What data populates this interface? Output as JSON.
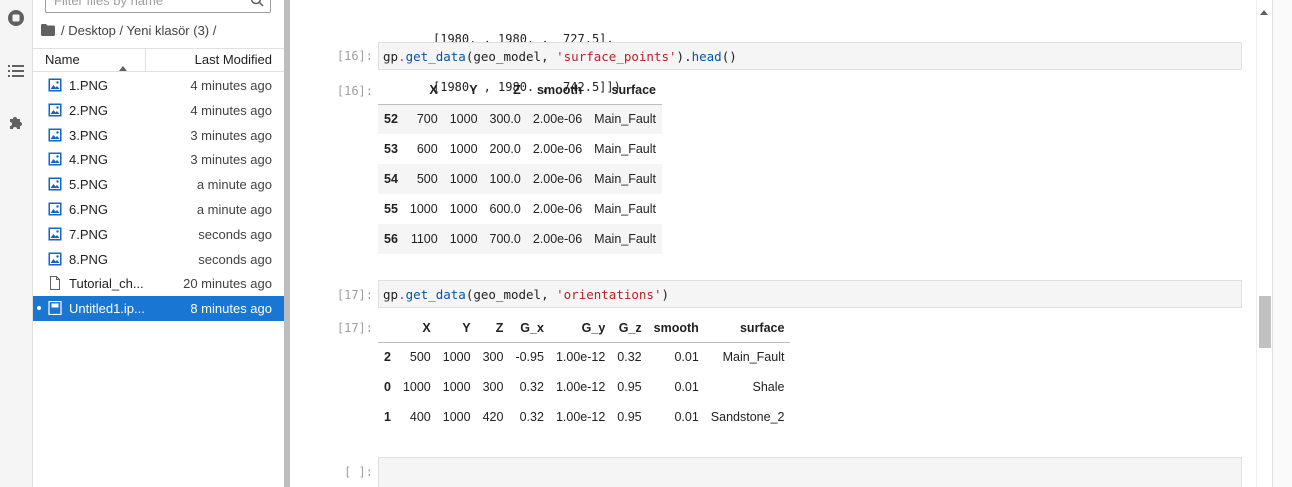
{
  "sidebar": {
    "icons": [
      "running-icon",
      "toc-icon",
      "extension-icon"
    ]
  },
  "filebrowser": {
    "search_placeholder": "Filter files by name",
    "breadcrumb": "/ Desktop / Yeni klasör (3) /",
    "header": {
      "name": "Name",
      "modified": "Last Modified"
    },
    "files": [
      {
        "name": "1.PNG",
        "modified": "4 minutes ago",
        "icon": "image-icon"
      },
      {
        "name": "2.PNG",
        "modified": "4 minutes ago",
        "icon": "image-icon"
      },
      {
        "name": "3.PNG",
        "modified": "3 minutes ago",
        "icon": "image-icon"
      },
      {
        "name": "4.PNG",
        "modified": "3 minutes ago",
        "icon": "image-icon"
      },
      {
        "name": "5.PNG",
        "modified": "a minute ago",
        "icon": "image-icon"
      },
      {
        "name": "6.PNG",
        "modified": "a minute ago",
        "icon": "image-icon"
      },
      {
        "name": "7.PNG",
        "modified": "seconds ago",
        "icon": "image-icon"
      },
      {
        "name": "8.PNG",
        "modified": "seconds ago",
        "icon": "image-icon"
      },
      {
        "name": "Tutorial_ch...",
        "modified": "20 minutes ago",
        "icon": "file-icon"
      },
      {
        "name": "Untitled1.ip...",
        "modified": "8 minutes ago",
        "icon": "notebook-icon",
        "selected": true
      }
    ]
  },
  "notebook": {
    "prev_output": {
      "line1": "[1980. , 1980. ,  727.5],",
      "line2": "[1980. , 1980. ,  742.5]])"
    },
    "cell16": {
      "in_prompt": "[16]:",
      "out_prompt": "[16]:",
      "code": {
        "obj": "gp",
        "dot": ".",
        "func": "get_data",
        "open": "(geo_model, ",
        "arg": "'surface_points'",
        "close": ").",
        "method": "head",
        "end": "()"
      },
      "table": {
        "columns": [
          "",
          "X",
          "Y",
          "Z",
          "smooth",
          "surface"
        ],
        "rows": [
          [
            "52",
            "700",
            "1000",
            "300.0",
            "2.00e-06",
            "Main_Fault"
          ],
          [
            "53",
            "600",
            "1000",
            "200.0",
            "2.00e-06",
            "Main_Fault"
          ],
          [
            "54",
            "500",
            "1000",
            "100.0",
            "2.00e-06",
            "Main_Fault"
          ],
          [
            "55",
            "1000",
            "1000",
            "600.0",
            "2.00e-06",
            "Main_Fault"
          ],
          [
            "56",
            "1100",
            "1000",
            "700.0",
            "2.00e-06",
            "Main_Fault"
          ]
        ]
      }
    },
    "cell17": {
      "in_prompt": "[17]:",
      "out_prompt": "[17]:",
      "code": {
        "obj": "gp",
        "dot": ".",
        "func": "get_data",
        "open": "(geo_model, ",
        "arg": "'orientations'",
        "close": ")"
      },
      "table": {
        "columns": [
          "",
          "X",
          "Y",
          "Z",
          "G_x",
          "G_y",
          "G_z",
          "smooth",
          "surface"
        ],
        "rows": [
          [
            "2",
            "500",
            "1000",
            "300",
            "-0.95",
            "1.00e-12",
            "0.32",
            "0.01",
            "Main_Fault"
          ],
          [
            "0",
            "1000",
            "1000",
            "300",
            "0.32",
            "1.00e-12",
            "0.95",
            "0.01",
            "Shale"
          ],
          [
            "1",
            "400",
            "1000",
            "420",
            "0.32",
            "1.00e-12",
            "0.95",
            "0.01",
            "Sandstone_2"
          ]
        ]
      }
    },
    "empty_cell": {
      "in_prompt": "[ ]:"
    }
  }
}
